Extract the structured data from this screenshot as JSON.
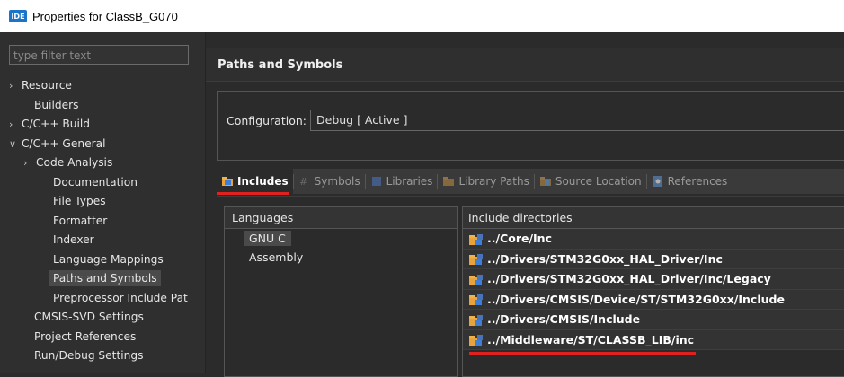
{
  "window": {
    "icon_text": "IDE",
    "title": "Properties for ClassB_G070"
  },
  "filter": {
    "placeholder": "type filter text"
  },
  "tree": [
    {
      "label": "Resource",
      "arrow": ">",
      "indent": 0
    },
    {
      "label": "Builders",
      "arrow": "",
      "indent": 1
    },
    {
      "label": "C/C++ Build",
      "arrow": ">",
      "indent": 0
    },
    {
      "label": "C/C++ General",
      "arrow": "v",
      "indent": 0
    },
    {
      "label": "Code Analysis",
      "arrow": ">",
      "indent": 1
    },
    {
      "label": "Documentation",
      "arrow": "",
      "indent": 2
    },
    {
      "label": "File Types",
      "arrow": "",
      "indent": 2
    },
    {
      "label": "Formatter",
      "arrow": "",
      "indent": 2
    },
    {
      "label": "Indexer",
      "arrow": "",
      "indent": 2
    },
    {
      "label": "Language Mappings",
      "arrow": "",
      "indent": 2
    },
    {
      "label": "Paths and Symbols",
      "arrow": "",
      "indent": 2,
      "selected": true
    },
    {
      "label": "Preprocessor Include Pat",
      "arrow": "",
      "indent": 2
    },
    {
      "label": "CMSIS-SVD Settings",
      "arrow": "",
      "indent": 1
    },
    {
      "label": "Project References",
      "arrow": "",
      "indent": 1
    },
    {
      "label": "Run/Debug Settings",
      "arrow": "",
      "indent": 1
    }
  ],
  "page": {
    "title": "Paths and Symbols"
  },
  "configuration": {
    "label": "Configuration:",
    "value": "Debug  [ Active ]"
  },
  "tabs": [
    {
      "label": "Includes",
      "icon": "includes-icon",
      "active": true
    },
    {
      "label": "Symbols",
      "icon": "symbols-icon"
    },
    {
      "label": "Libraries",
      "icon": "libraries-icon"
    },
    {
      "label": "Library Paths",
      "icon": "library-paths-icon"
    },
    {
      "label": "Source Location",
      "icon": "source-location-icon"
    },
    {
      "label": "References",
      "icon": "references-icon"
    }
  ],
  "languages": {
    "header": "Languages",
    "items": [
      "GNU C",
      "Assembly"
    ],
    "selected": "GNU C"
  },
  "includes": {
    "header": "Include directories",
    "items": [
      "../Core/Inc",
      "../Drivers/STM32G0xx_HAL_Driver/Inc",
      "../Drivers/STM32G0xx_HAL_Driver/Inc/Legacy",
      "../Drivers/CMSIS/Device/ST/STM32G0xx/Include",
      "../Drivers/CMSIS/Include",
      "../Middleware/ST/CLASSB_LIB/inc"
    ]
  },
  "colors": {
    "accent_underline": "#e0211f",
    "ide_badge": "#1b74c9",
    "folder_icon": "#e8a33a"
  }
}
